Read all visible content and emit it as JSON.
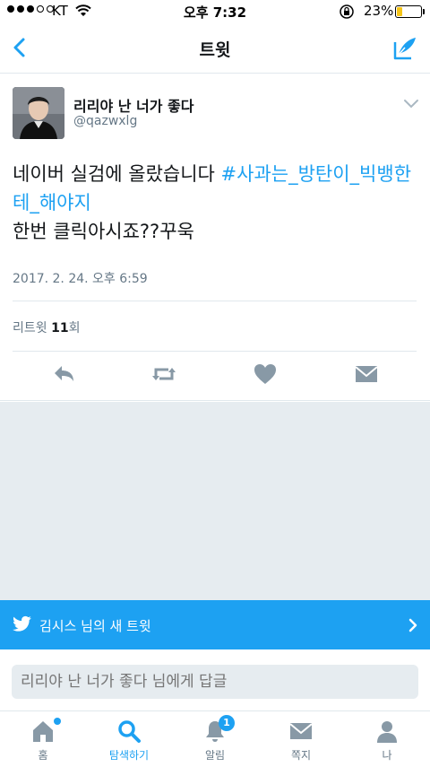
{
  "status_bar": {
    "carrier": "KT",
    "time": "오후 7:32",
    "battery": "23%",
    "battery_level": 0.23
  },
  "nav": {
    "title": "트윗"
  },
  "tweet": {
    "display_name": "리리야 난 너가 좋다",
    "handle": "@qazwxlg",
    "text_part1": "네이버 실검에 올랐습니다 ",
    "hashtag": "#사과는_방탄이_빅뱅한테_해야지",
    "text_part2": "한번 클릭아시죠??꾸욱",
    "date": "2017. 2. 24. 오후 6:59",
    "retweet_label": "리트윗 ",
    "retweet_count": "11",
    "retweet_suffix": "회"
  },
  "banner": {
    "text": "김시스 님의 새 트윗"
  },
  "reply": {
    "placeholder": "리리야 난 너가 좋다 님에게 답글"
  },
  "tabs": [
    {
      "label": "홈",
      "icon": "home-icon"
    },
    {
      "label": "탐색하기",
      "icon": "search-icon"
    },
    {
      "label": "알림",
      "icon": "bell-icon",
      "badge": "1"
    },
    {
      "label": "쪽지",
      "icon": "envelope-icon"
    },
    {
      "label": "나",
      "icon": "person-icon"
    }
  ],
  "colors": {
    "accent": "#1da1f2",
    "gray_text": "#657786",
    "icon_gray": "#8899a6",
    "panel": "#e6ecf0"
  }
}
